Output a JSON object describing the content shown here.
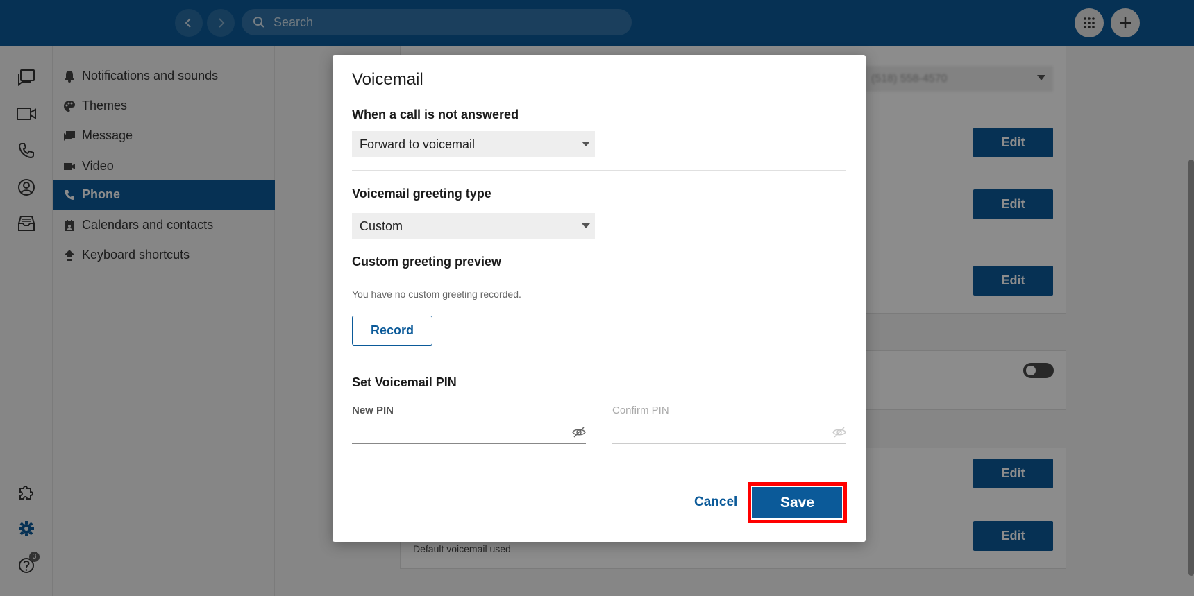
{
  "topbar": {
    "search_placeholder": "Search",
    "back_icon": "chevron-left-icon",
    "forward_icon": "chevron-right-icon",
    "dialpad_icon": "dialpad-icon",
    "add_icon": "plus-icon"
  },
  "rail": {
    "items": [
      {
        "icon": "chat-icon"
      },
      {
        "icon": "video-icon"
      },
      {
        "icon": "phone-icon"
      },
      {
        "icon": "contacts-icon"
      },
      {
        "icon": "inbox-icon"
      }
    ],
    "bottom": [
      {
        "icon": "puzzle-icon"
      },
      {
        "icon": "gear-icon"
      },
      {
        "icon": "help-icon",
        "badge": "3"
      }
    ]
  },
  "menu": {
    "items": [
      {
        "label": "Notifications and sounds",
        "icon": "bell-icon"
      },
      {
        "label": "Themes",
        "icon": "palette-icon"
      },
      {
        "label": "Message",
        "icon": "message-icon"
      },
      {
        "label": "Video",
        "icon": "video-icon"
      },
      {
        "label": "Phone",
        "icon": "phone-icon",
        "active": true
      },
      {
        "label": "Calendars and contacts",
        "icon": "calendar-icon"
      },
      {
        "label": "Keyboard shortcuts",
        "icon": "keyboard-icon"
      }
    ]
  },
  "background": {
    "select_value": "(518) 558-4570",
    "edit_label": "Edit",
    "default_voicemail_text": "Default voicemail used"
  },
  "dialog": {
    "title": "Voicemail",
    "unanswered": {
      "label": "When a call is not answered",
      "value": "Forward to voicemail"
    },
    "greeting_type": {
      "label": "Voicemail greeting type",
      "value": "Custom"
    },
    "preview": {
      "label": "Custom greeting preview",
      "hint": "You have no custom greeting recorded.",
      "record_label": "Record"
    },
    "pin": {
      "label": "Set Voicemail PIN",
      "new_label": "New PIN",
      "confirm_label": "Confirm PIN"
    },
    "cancel_label": "Cancel",
    "save_label": "Save"
  },
  "colors": {
    "brand": "#0b5a99",
    "highlight": "#ff0000"
  }
}
